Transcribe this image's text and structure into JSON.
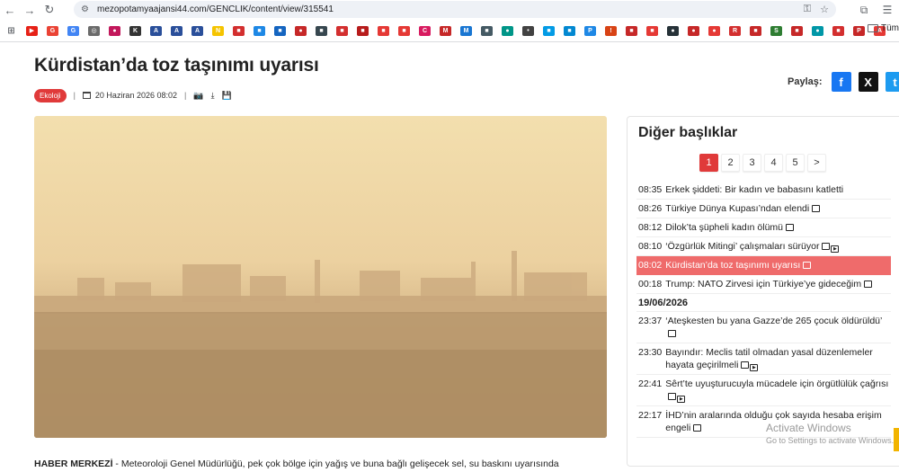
{
  "browser": {
    "url": "mezopotamyaajansi44.com/GENCLIK/content/view/315541",
    "nav": [
      "back-icon",
      "forward-icon",
      "reload-icon"
    ],
    "bookmark_folder": "Tüm"
  },
  "bookmarks": [
    {
      "color": "#e62117",
      "t": "▶"
    },
    {
      "color": "#ea4335",
      "t": "G"
    },
    {
      "color": "#4285f4",
      "t": "G"
    },
    {
      "color": "#6b6b6b",
      "t": "◎"
    },
    {
      "color": "#c2185b",
      "t": "●"
    },
    {
      "color": "#333333",
      "t": "K"
    },
    {
      "color": "#2a4f9a",
      "t": "A"
    },
    {
      "color": "#2a4f9a",
      "t": "A"
    },
    {
      "color": "#2a4f9a",
      "t": "A"
    },
    {
      "color": "#f5c400",
      "t": "N"
    },
    {
      "color": "#d32f2f",
      "t": "■"
    },
    {
      "color": "#1e88e5",
      "t": "■"
    },
    {
      "color": "#1565c0",
      "t": "■"
    },
    {
      "color": "#c62828",
      "t": "●"
    },
    {
      "color": "#37474f",
      "t": "■"
    },
    {
      "color": "#d32f2f",
      "t": "■"
    },
    {
      "color": "#b71c1c",
      "t": "■"
    },
    {
      "color": "#e53935",
      "t": "■"
    },
    {
      "color": "#e53935",
      "t": "■"
    },
    {
      "color": "#d81b60",
      "t": "C"
    },
    {
      "color": "#c62828",
      "t": "M"
    },
    {
      "color": "#1976d2",
      "t": "M"
    },
    {
      "color": "#455a64",
      "t": "■"
    },
    {
      "color": "#009688",
      "t": "●"
    },
    {
      "color": "#424242",
      "t": "•"
    },
    {
      "color": "#039be5",
      "t": "■"
    },
    {
      "color": "#0288d1",
      "t": "■"
    },
    {
      "color": "#1e88e5",
      "t": "P"
    },
    {
      "color": "#d84315",
      "t": "!"
    },
    {
      "color": "#c62828",
      "t": "■"
    },
    {
      "color": "#e53935",
      "t": "■"
    },
    {
      "color": "#263238",
      "t": "●"
    },
    {
      "color": "#c62828",
      "t": "●"
    },
    {
      "color": "#e53935",
      "t": "●"
    },
    {
      "color": "#d32f2f",
      "t": "R"
    },
    {
      "color": "#c62828",
      "t": "■"
    },
    {
      "color": "#2e7d32",
      "t": "S"
    },
    {
      "color": "#c62828",
      "t": "■"
    },
    {
      "color": "#0097a7",
      "t": "●"
    },
    {
      "color": "#d32f2f",
      "t": "■"
    },
    {
      "color": "#c62828",
      "t": "P"
    },
    {
      "color": "#e53935",
      "t": "A"
    }
  ],
  "article": {
    "title": "Kürdistan’da toz taşınımı uyarısı",
    "category": "Ekoloji",
    "date": "20 Haziran 2026 08:02",
    "lead_bold": "HABER MERKEZİ",
    "lead_text": " - Meteoroloji Genel Müdürlüğü, pek çok bölge için yağış ve buna bağlı gelişecek sel, su baskını uyarısında"
  },
  "share": {
    "label": "Paylaş:",
    "buttons": [
      {
        "name": "facebook",
        "glyph": "f",
        "color": "#1877f2"
      },
      {
        "name": "x",
        "glyph": "X",
        "color": "#111111"
      },
      {
        "name": "twitter",
        "glyph": "t",
        "color": "#1d9bf0"
      }
    ]
  },
  "sidebar": {
    "title": "Diğer başlıklar",
    "pages": [
      "1",
      "2",
      "3",
      "4",
      "5",
      ">"
    ],
    "active_page": "1",
    "date_header": "19/06/2026",
    "items_today": [
      {
        "time": "08:35",
        "text": "Erkek şiddeti: Bir kadın ve babasını katletti",
        "pic": false,
        "vid": false
      },
      {
        "time": "08:26",
        "text": "Türkiye Dünya Kupası’ndan elendi",
        "pic": true,
        "vid": false
      },
      {
        "time": "08:12",
        "text": "Dilok’ta şüpheli kadın ölümü",
        "pic": true,
        "vid": false
      },
      {
        "time": "08:10",
        "text": "‘Özgürlük Mitingi’ çalışmaları sürüyor",
        "pic": true,
        "vid": true
      },
      {
        "time": "08:02",
        "text": "Kürdistan’da toz taşınımı uyarısı",
        "pic": true,
        "vid": false,
        "active": true
      },
      {
        "time": "00:18",
        "text": "Trump: NATO Zirvesi için Türkiye’ye gideceğim",
        "pic": true,
        "vid": false
      }
    ],
    "items_prev": [
      {
        "time": "23:37",
        "text": "‘Ateşkesten bu yana Gazze’de 265 çocuk öldürüldü’",
        "pic": true,
        "vid": false
      },
      {
        "time": "23:30",
        "text": "Bayındır: Meclis tatil olmadan yasal düzenlemeler hayata geçirilmeli",
        "pic": true,
        "vid": true
      },
      {
        "time": "22:41",
        "text": "Sêrt’te uyuşturucuyla mücadele için örgütlülük çağrısı",
        "pic": true,
        "vid": true
      },
      {
        "time": "22:17",
        "text": "İHD’nin aralarında olduğu çok sayıda hesaba erişim engeli",
        "pic": true,
        "vid": false
      }
    ]
  },
  "watermark": {
    "line1": "Activate Windows",
    "line2": "Go to Settings to activate Windows."
  }
}
